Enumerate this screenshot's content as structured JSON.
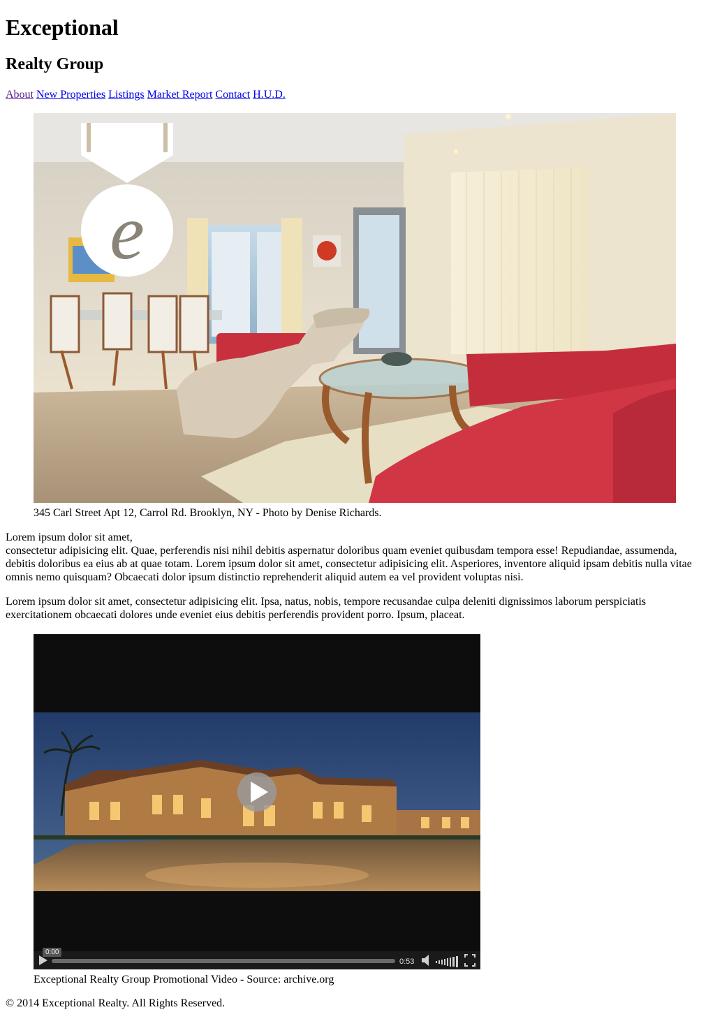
{
  "header": {
    "title": "Exceptional",
    "subtitle": "Realty Group"
  },
  "nav": {
    "items": [
      {
        "label": "About",
        "visited": true
      },
      {
        "label": "New Properties",
        "visited": false
      },
      {
        "label": "Listings",
        "visited": false
      },
      {
        "label": "Market Report",
        "visited": false
      },
      {
        "label": "Contact",
        "visited": false
      },
      {
        "label": "H.U.D.",
        "visited": false
      }
    ]
  },
  "hero": {
    "caption": "345 Carl Street Apt 12, Carrol Rd. Brooklyn, NY - Photo by Denise Richards.",
    "logo_letter": "e"
  },
  "content": {
    "paragraph1_line1": "Lorem ipsum dolor sit amet,",
    "paragraph1_rest": "consectetur adipisicing elit. Quae, perferendis nisi nihil debitis aspernatur doloribus quam eveniet quibusdam tempora esse! Repudiandae, assumenda, debitis doloribus ea eius ab at quae totam. Lorem ipsum dolor sit amet, consectetur adipisicing elit. Asperiores, inventore aliquid ipsam debitis nulla vitae omnis nemo quisquam? Obcaecati dolor ipsum distinctio reprehenderit aliquid autem ea vel provident voluptas nisi.",
    "paragraph2": "Lorem ipsum dolor sit amet, consectetur adipisicing elit. Ipsa, natus, nobis, tempore recusandae culpa deleniti dignissimos laborum perspiciatis exercitationem obcaecati dolores unde eveniet eius debitis perferendis provident porro. Ipsum, placeat."
  },
  "video": {
    "caption": "Exceptional Realty Group Promotional Video - Source: archive.org",
    "current_time": "0:00",
    "duration": "0:53",
    "progress": 0.0
  },
  "footer": {
    "copyright": "© 2014 Exceptional Realty. All Rights Reserved."
  }
}
